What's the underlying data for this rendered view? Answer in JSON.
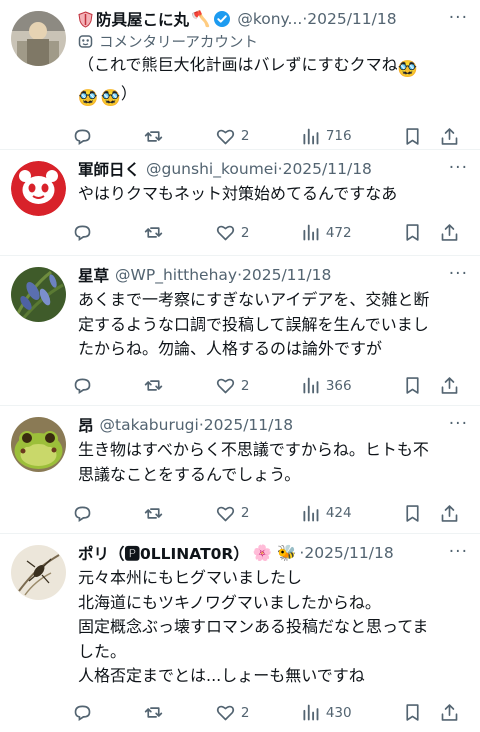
{
  "tweets": [
    {
      "name": "防具屋こに丸",
      "name_emoji": "🪓",
      "handle": "@kony...",
      "dot": "·",
      "date": "2025/11/18",
      "label": "コメンタリーアカウント",
      "text_line1": "（これで熊巨大化計画はバレずにすむクマね",
      "text_line2": "）",
      "body_emoji": "🥸",
      "likes": "2",
      "views": "716",
      "verified": true,
      "more": "···"
    },
    {
      "name": "軍師日く",
      "handle": "@gunshi_koumei",
      "dot": "·",
      "date": "2025/11/18",
      "text": "やはりクマもネット対策始めてるんですなあ",
      "likes": "2",
      "views": "472"
    },
    {
      "name": "星草",
      "handle": "@WP_hitthehay",
      "dot": "·",
      "date": "2025/11/18",
      "text_lines": [
        "あくまで一考察にすぎないアイデアを、交雑と断",
        "定するような口調で投稿して誤解を生んでいまし",
        "たからね。勿論、人格するのは論外ですが"
      ],
      "likes": "2",
      "views": "366"
    },
    {
      "name": "昂",
      "handle": "@takaburugi",
      "dot": "·",
      "date": "2025/11/18",
      "text_lines": [
        "生き物はすべからく不思議ですからね。ヒトも不",
        "思議なことをするんでしょう。"
      ],
      "likes": "2",
      "views": "424"
    },
    {
      "name": "ポリ（🅿0LLINAT0R）",
      "name_emojis": "🌸 🐝",
      "dot": "·",
      "date": "2025/11/18",
      "text_lines": [
        "元々本州にもヒグマいましたし",
        "北海道にもツキノワグマいましたからね。",
        "固定概念ぶっ壊すロマンある投稿だなと思ってま",
        "した。",
        "人格否定までとは...しょーも無いですね"
      ],
      "likes": "2",
      "views": "430"
    }
  ]
}
